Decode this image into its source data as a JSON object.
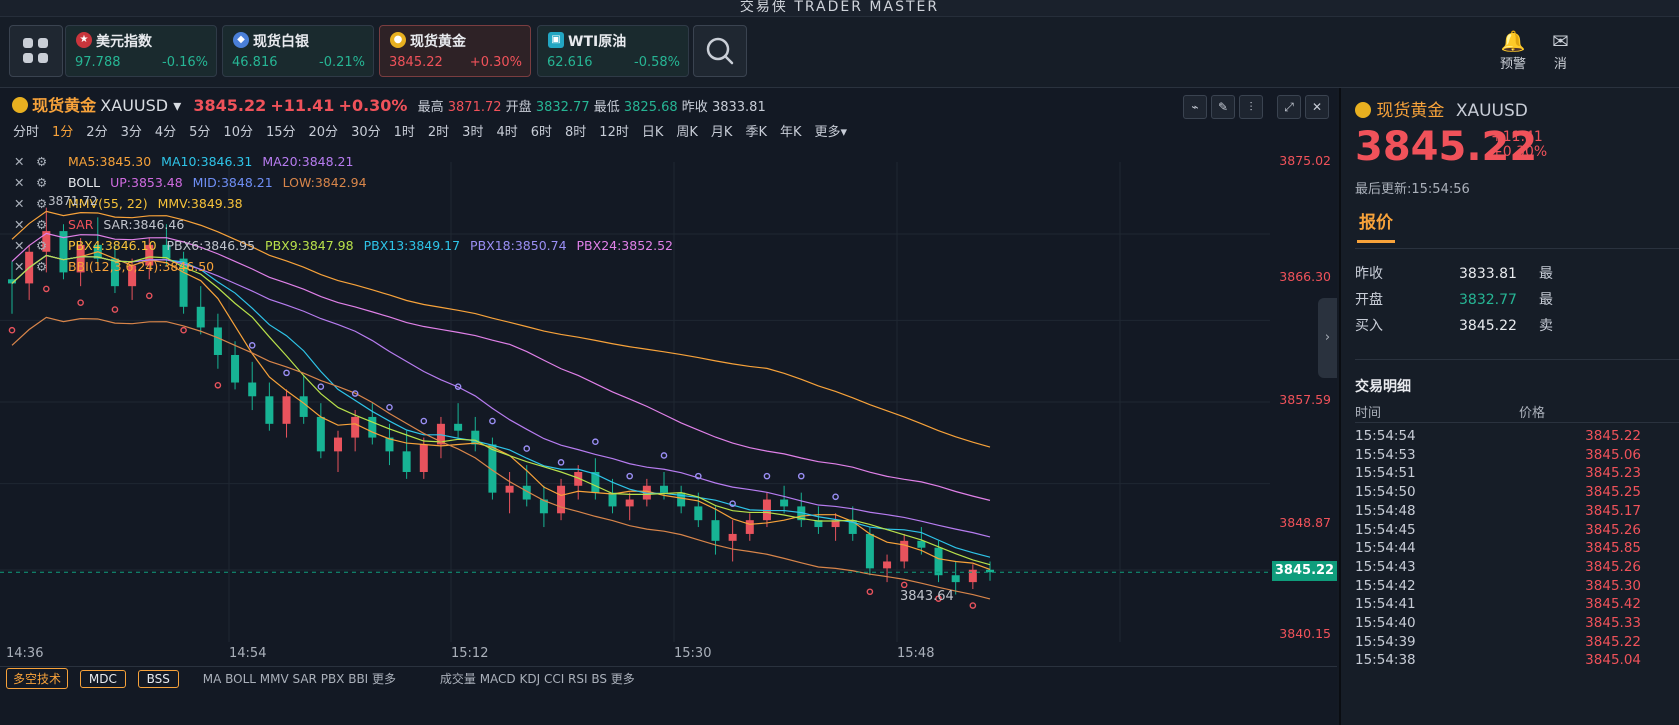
{
  "app": {
    "title": "交易侠 TRADER MASTER"
  },
  "tickers": [
    {
      "name": "美元指数",
      "price": "97.788",
      "change": "-0.16%",
      "dir": "down"
    },
    {
      "name": "现货白银",
      "price": "46.816",
      "change": "-0.21%",
      "dir": "down"
    },
    {
      "name": "现货黄金",
      "price": "3845.22",
      "change": "+0.30%",
      "dir": "up"
    },
    {
      "name": "WTI原油",
      "price": "62.616",
      "change": "-0.58%",
      "dir": "down"
    }
  ],
  "right_tools": {
    "alert": "预警",
    "msg": "消"
  },
  "chart": {
    "name": "现货黄金",
    "symbol": "XAUUSD",
    "price": "3845.22",
    "change": "+11.41",
    "change_pct": "+0.30%",
    "high_label": "最高",
    "high": "3871.72",
    "open_label": "开盘",
    "open": "3832.77",
    "low_label": "最低",
    "low": "3825.68",
    "prev_label": "昨收",
    "prev": "3833.81",
    "timeframes": [
      "分时",
      "1分",
      "2分",
      "3分",
      "4分",
      "5分",
      "10分",
      "15分",
      "20分",
      "30分",
      "1时",
      "2时",
      "3时",
      "4时",
      "6时",
      "8时",
      "12时",
      "日K",
      "周K",
      "月K",
      "季K",
      "年K",
      "更多▾"
    ],
    "active_timeframe": "1分",
    "indicators": {
      "ma": [
        "MA5:3845.30",
        "MA10:3846.31",
        "MA20:3848.21"
      ],
      "boll": [
        "BOLL",
        "UP:3853.48",
        "MID:3848.21",
        "LOW:3842.94"
      ],
      "mmv": [
        "MMV(55, 22)",
        "MMV:3849.38"
      ],
      "sar": [
        "SAR",
        "SAR:3846.46"
      ],
      "pbx": [
        "PBX4:3846.10",
        "PBX6:3846.95",
        "PBX9:3847.98",
        "PBX13:3849.17",
        "PBX18:3850.74",
        "PBX24:3852.52"
      ],
      "bbi": [
        "BBI(12,3,6,24):3846.50"
      ],
      "high_mark": "3871.72"
    },
    "y_ticks": [
      "3875.02",
      "3866.30",
      "3857.59",
      "3848.87",
      "3845.22",
      "3840.15"
    ],
    "low_mark": "3843.64",
    "x_ticks": [
      "14:36",
      "14:54",
      "15:12",
      "15:30",
      "15:48"
    ],
    "bottom_buttons": [
      "多空技术",
      "MDC",
      "BSS"
    ],
    "bottom_inds": "MA BOLL MMV SAR PBX BBI 更多",
    "bottom_inds2": "成交量 MACD KDJ CCI RSI BS 更多"
  },
  "panel": {
    "name": "现货黄金",
    "symbol": "XAUUSD",
    "price": "3845.22",
    "change": "+11.41",
    "change_pct": "+0.30%",
    "updated": "最后更新:15:54:56",
    "tab": "报价",
    "quote": [
      {
        "k": "昨收",
        "v": "3833.81",
        "k2": "最"
      },
      {
        "k": "开盘",
        "v": "3832.77",
        "k2": "最"
      },
      {
        "k": "买入",
        "v": "3845.22",
        "k2": "卖"
      }
    ],
    "trades_title": "交易明细",
    "time_label": "时间",
    "price_label": "价格",
    "trades": [
      [
        "15:54:54",
        "3845.22"
      ],
      [
        "15:54:53",
        "3845.06"
      ],
      [
        "15:54:51",
        "3845.23"
      ],
      [
        "15:54:50",
        "3845.25"
      ],
      [
        "15:54:48",
        "3845.17"
      ],
      [
        "15:54:45",
        "3845.26"
      ],
      [
        "15:54:44",
        "3845.85"
      ],
      [
        "15:54:43",
        "3845.26"
      ],
      [
        "15:54:42",
        "3845.30"
      ],
      [
        "15:54:41",
        "3845.42"
      ],
      [
        "15:54:40",
        "3845.33"
      ],
      [
        "15:54:39",
        "3845.22"
      ],
      [
        "15:54:38",
        "3845.04"
      ]
    ]
  },
  "chart_data": {
    "type": "candlestick",
    "ylim": [
      3840.15,
      3875.02
    ],
    "candles": [
      [
        3866.5,
        3867.8,
        3864.0,
        3866.2
      ],
      [
        3866.2,
        3869.0,
        3865.0,
        3868.5
      ],
      [
        3868.5,
        3871.7,
        3867.0,
        3870.0
      ],
      [
        3870.0,
        3870.5,
        3866.5,
        3867.0
      ],
      [
        3867.0,
        3869.5,
        3866.0,
        3869.0
      ],
      [
        3869.0,
        3871.0,
        3867.5,
        3868.0
      ],
      [
        3868.0,
        3869.0,
        3865.5,
        3866.0
      ],
      [
        3866.0,
        3868.0,
        3865.0,
        3867.5
      ],
      [
        3867.5,
        3869.5,
        3866.5,
        3869.0
      ],
      [
        3869.0,
        3870.5,
        3867.5,
        3868.0
      ],
      [
        3868.0,
        3868.5,
        3864.0,
        3864.5
      ],
      [
        3864.5,
        3866.0,
        3862.5,
        3863.0
      ],
      [
        3863.0,
        3864.0,
        3860.0,
        3861.0
      ],
      [
        3861.0,
        3862.0,
        3858.5,
        3859.0
      ],
      [
        3859.0,
        3860.5,
        3857.0,
        3858.0
      ],
      [
        3858.0,
        3859.0,
        3855.5,
        3856.0
      ],
      [
        3856.0,
        3858.5,
        3855.0,
        3858.0
      ],
      [
        3858.0,
        3859.5,
        3856.0,
        3856.5
      ],
      [
        3856.5,
        3857.5,
        3853.5,
        3854.0
      ],
      [
        3854.0,
        3855.5,
        3852.5,
        3855.0
      ],
      [
        3855.0,
        3857.0,
        3854.0,
        3856.5
      ],
      [
        3856.5,
        3857.5,
        3854.5,
        3855.0
      ],
      [
        3855.0,
        3856.0,
        3853.0,
        3854.0
      ],
      [
        3854.0,
        3855.5,
        3852.0,
        3852.5
      ],
      [
        3852.5,
        3855.0,
        3852.0,
        3854.5
      ],
      [
        3854.5,
        3856.5,
        3853.5,
        3856.0
      ],
      [
        3856.0,
        3857.5,
        3855.0,
        3855.5
      ],
      [
        3855.5,
        3856.5,
        3854.0,
        3854.5
      ],
      [
        3854.5,
        3855.0,
        3850.5,
        3851.0
      ],
      [
        3851.0,
        3852.5,
        3849.5,
        3851.5
      ],
      [
        3851.5,
        3853.0,
        3850.0,
        3850.5
      ],
      [
        3850.5,
        3851.5,
        3848.5,
        3849.5
      ],
      [
        3849.5,
        3852.0,
        3849.0,
        3851.5
      ],
      [
        3851.5,
        3853.0,
        3850.5,
        3852.5
      ],
      [
        3852.5,
        3853.5,
        3850.5,
        3851.0
      ],
      [
        3851.0,
        3852.0,
        3849.5,
        3850.0
      ],
      [
        3850.0,
        3851.0,
        3849.0,
        3850.5
      ],
      [
        3850.5,
        3852.0,
        3850.0,
        3851.5
      ],
      [
        3851.5,
        3852.5,
        3850.5,
        3851.0
      ],
      [
        3851.0,
        3851.5,
        3849.5,
        3850.0
      ],
      [
        3850.0,
        3851.0,
        3848.5,
        3849.0
      ],
      [
        3849.0,
        3850.0,
        3846.5,
        3847.5
      ],
      [
        3847.5,
        3849.0,
        3846.0,
        3848.0
      ],
      [
        3848.0,
        3849.5,
        3847.5,
        3849.0
      ],
      [
        3849.0,
        3851.0,
        3848.5,
        3850.5
      ],
      [
        3850.5,
        3851.5,
        3849.5,
        3850.0
      ],
      [
        3850.0,
        3851.0,
        3848.5,
        3849.0
      ],
      [
        3849.0,
        3850.0,
        3848.0,
        3848.5
      ],
      [
        3848.5,
        3849.5,
        3847.5,
        3849.0
      ],
      [
        3849.0,
        3850.0,
        3847.5,
        3848.0
      ],
      [
        3848.0,
        3848.5,
        3845.0,
        3845.5
      ],
      [
        3845.5,
        3846.5,
        3844.5,
        3846.0
      ],
      [
        3846.0,
        3848.0,
        3845.5,
        3847.5
      ],
      [
        3847.5,
        3848.5,
        3846.5,
        3847.0
      ],
      [
        3847.0,
        3847.5,
        3844.5,
        3845.0
      ],
      [
        3845.0,
        3846.0,
        3843.6,
        3844.5
      ],
      [
        3844.5,
        3845.8,
        3844.0,
        3845.4
      ],
      [
        3845.4,
        3846.0,
        3844.6,
        3845.22
      ]
    ]
  }
}
